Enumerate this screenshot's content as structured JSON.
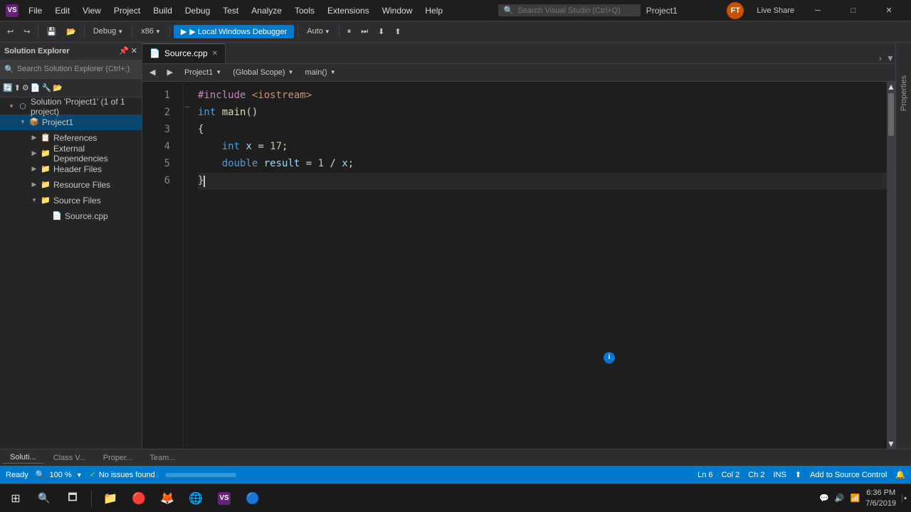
{
  "titleBar": {
    "appIcon": "VS",
    "menus": [
      "File",
      "Edit",
      "View",
      "Project",
      "Build",
      "Debug",
      "Test",
      "Analyze",
      "Tools",
      "Extensions",
      "Window",
      "Help"
    ],
    "searchPlaceholder": "Search Visual Studio (Ctrl+Q)",
    "title": "Project1",
    "userAvatar": "FT",
    "liveShareLabel": "Live Share",
    "windowControls": [
      "─",
      "□",
      "✕"
    ]
  },
  "toolbar": {
    "saveBtn": "💾",
    "debugConfig": "Debug",
    "platform": "x86",
    "runBtn": "▶ Local Windows Debugger",
    "autoLabel": "Auto"
  },
  "solutionExplorer": {
    "title": "Solution Explorer",
    "searchPlaceholder": "Search Solution Explorer (Ctrl+;)",
    "tree": {
      "solution": "Solution 'Project1' (1 of 1 project)",
      "project": "Project1",
      "references": "References",
      "externalDeps": "External Dependencies",
      "headerFiles": "Header Files",
      "resourceFiles": "Resource Files",
      "sourceFiles": "Source Files",
      "sourceCpp": "Source.cpp"
    }
  },
  "editor": {
    "activeTab": "Source.cpp",
    "navLeft": "Project1",
    "navMiddle": "(Global Scope)",
    "navRight": "main()",
    "lines": [
      {
        "num": "1",
        "content": "#include <iostream>"
      },
      {
        "num": "2",
        "content": "int main()"
      },
      {
        "num": "3",
        "content": "{"
      },
      {
        "num": "4",
        "content": "    int x = 17;"
      },
      {
        "num": "5",
        "content": "    double result = 1 / x;"
      },
      {
        "num": "6",
        "content": "}"
      }
    ]
  },
  "bottomTabs": [
    "Soluti...",
    "Class V...",
    "Proper...",
    "Team..."
  ],
  "statusBar": {
    "ready": "Ready",
    "zoomLabel": "100 %",
    "issues": "No issues found",
    "lineCol": "Ln 6",
    "col": "Col 2",
    "ch": "Ch 2",
    "ins": "INS",
    "sourceControl": "Add to Source Control"
  },
  "taskbar": {
    "time": "6:36 PM",
    "date": "7/6/2019",
    "icons": [
      "⊞",
      "🔍",
      "📁",
      "🔴",
      "🌐",
      "🟢",
      "🔵"
    ]
  },
  "rightSidebar": {
    "panelLabel": "Properties"
  }
}
